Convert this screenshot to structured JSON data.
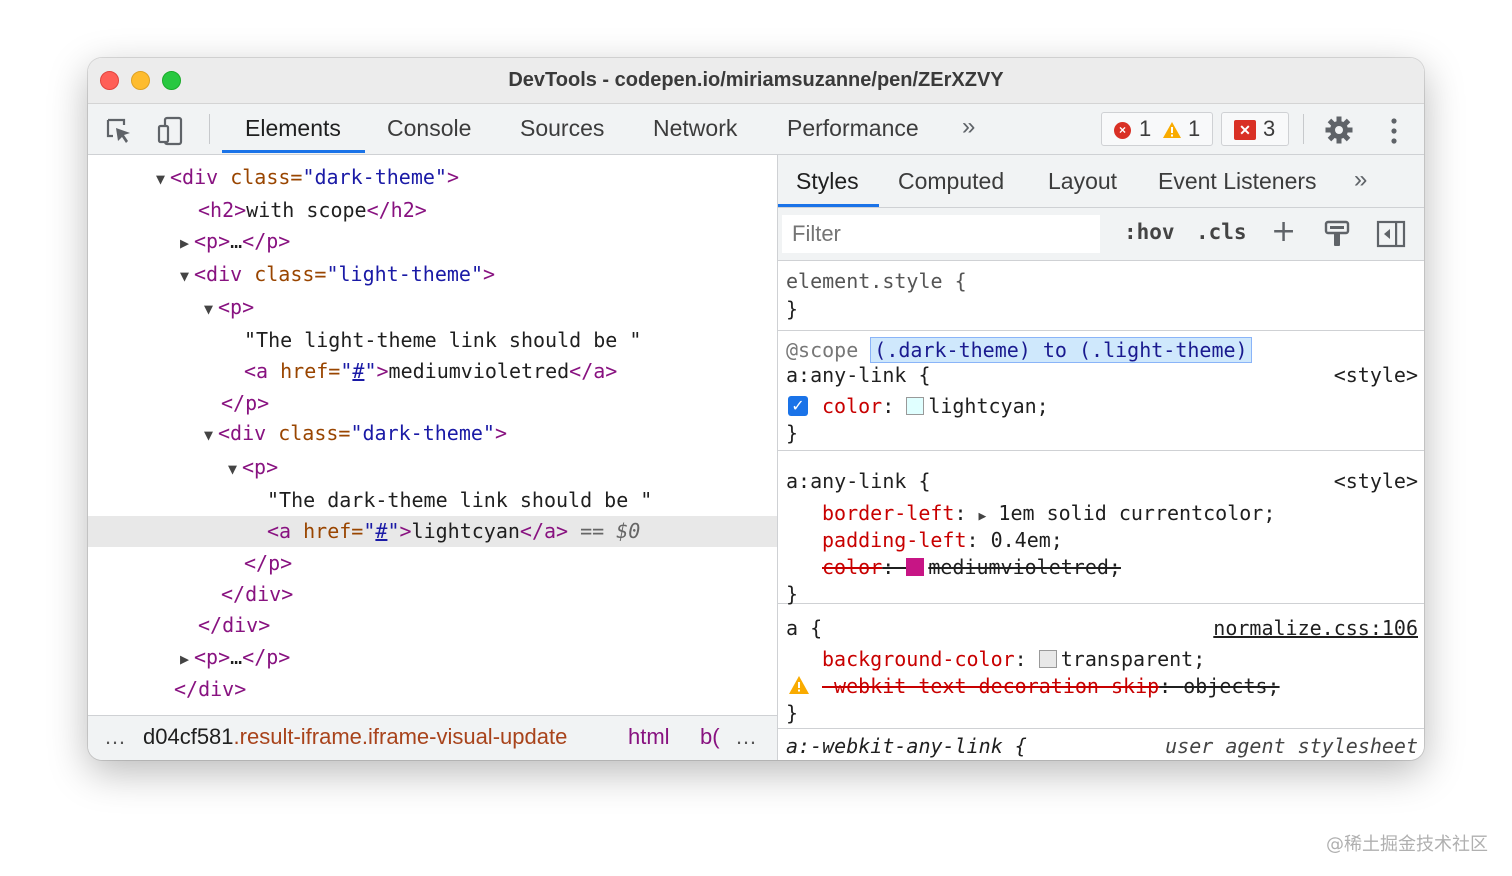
{
  "window": {
    "title": "DevTools - codepen.io/miriamsuzanne/pen/ZErXZVY"
  },
  "toolbar": {
    "icons": [
      "inspect-element-icon",
      "device-toolbar-icon",
      "settings-gear-icon",
      "more-options-icon"
    ],
    "tabs": [
      "Elements",
      "Console",
      "Sources",
      "Network",
      "Performance"
    ],
    "active_tab": "Elements",
    "more_tabs": "»",
    "errors_count": "1",
    "warnings_count": "1",
    "issues_count": "3",
    "error_glyph": "×",
    "issue_glyph": "✕"
  },
  "dom": {
    "lines": [
      {
        "t1": "<div ",
        "a1": "class=",
        "v1": "\"dark-theme\"",
        "t2": ">"
      },
      {
        "t1": "<h2>",
        "text": "with scope",
        "t2": "</h2>"
      },
      {
        "t1": "<p>",
        "text": "…",
        "t2": "</p>"
      },
      {
        "t1": "<div ",
        "a1": "class=",
        "v1": "\"light-theme\"",
        "t2": ">"
      },
      {
        "t1": "<p>"
      },
      {
        "text": "\"The light-theme link should be \""
      },
      {
        "t1": "<a ",
        "a1": "href=",
        "v1q": "\"",
        "link": "#",
        "v1q2": "\"",
        "t2": ">",
        "text": "mediumvioletred",
        "t3": "</a>"
      },
      {
        "t1": "</p>"
      },
      {
        "t1": "<div ",
        "a1": "class=",
        "v1": "\"dark-theme\"",
        "t2": ">"
      },
      {
        "t1": "<p>"
      },
      {
        "text": "\"The dark-theme link should be \""
      },
      {
        "t1": "<a ",
        "a1": "href=",
        "v1q": "\"",
        "link": "#",
        "v1q2": "\"",
        "t2": ">",
        "text": "lightcyan",
        "t3": "</a>",
        "eq": " == ",
        "dollar": "$0"
      },
      {
        "t1": "</p>"
      },
      {
        "t1": "</div>"
      },
      {
        "t1": "</div>"
      },
      {
        "t1": "<p>",
        "text": "…",
        "t2": "</p>"
      },
      {
        "t1": "</div>"
      }
    ],
    "expand_open": "▼",
    "expand_closed": "▶"
  },
  "breadcrumb": {
    "leading_dots": "…",
    "prefix": "d04cf581",
    "classes": ".result-iframe.iframe-visual-update",
    "html": "html",
    "body_partial": "b(",
    "trailing_dots": "…"
  },
  "styles": {
    "subtabs": [
      "Styles",
      "Computed",
      "Layout",
      "Event Listeners"
    ],
    "active_subtab": "Styles",
    "more": "»",
    "filter_placeholder": "Filter",
    "hov": ":hov",
    "cls": ".cls",
    "plus": "+",
    "rules": {
      "element_style_open": "element.style {",
      "close": "}",
      "scope_at": "@scope",
      "scope_sel": "(.dark-theme) to (.light-theme)",
      "any_link_sel": "a:any-link {",
      "style_source": "<style>",
      "color_prop": "color",
      "color_val": "lightcyan;",
      "border_left_prop": "border-left",
      "border_left_val": "1em solid currentcolor;",
      "padding_left_prop": "padding-left",
      "padding_left_val": "0.4em;",
      "color_strike_prop": "color",
      "color_strike_val": "mediumvioletred;",
      "a_sel": "a {",
      "normalize_source": "normalize.css:106",
      "bg_prop": "background-color",
      "bg_val": "transparent;",
      "webkit_prop": "-webkit-text-decoration-skip",
      "webkit_val": "objects;",
      "ua_sel": "a:-webkit-any-link {",
      "ua_source": "user agent stylesheet",
      "colon": ": "
    },
    "colors": {
      "lightcyan": "#e0ffff",
      "mediumvioletred": "#c71585",
      "transparent_swatch": "#e8e8e8"
    }
  },
  "watermark": "@稀土掘金技术社区"
}
